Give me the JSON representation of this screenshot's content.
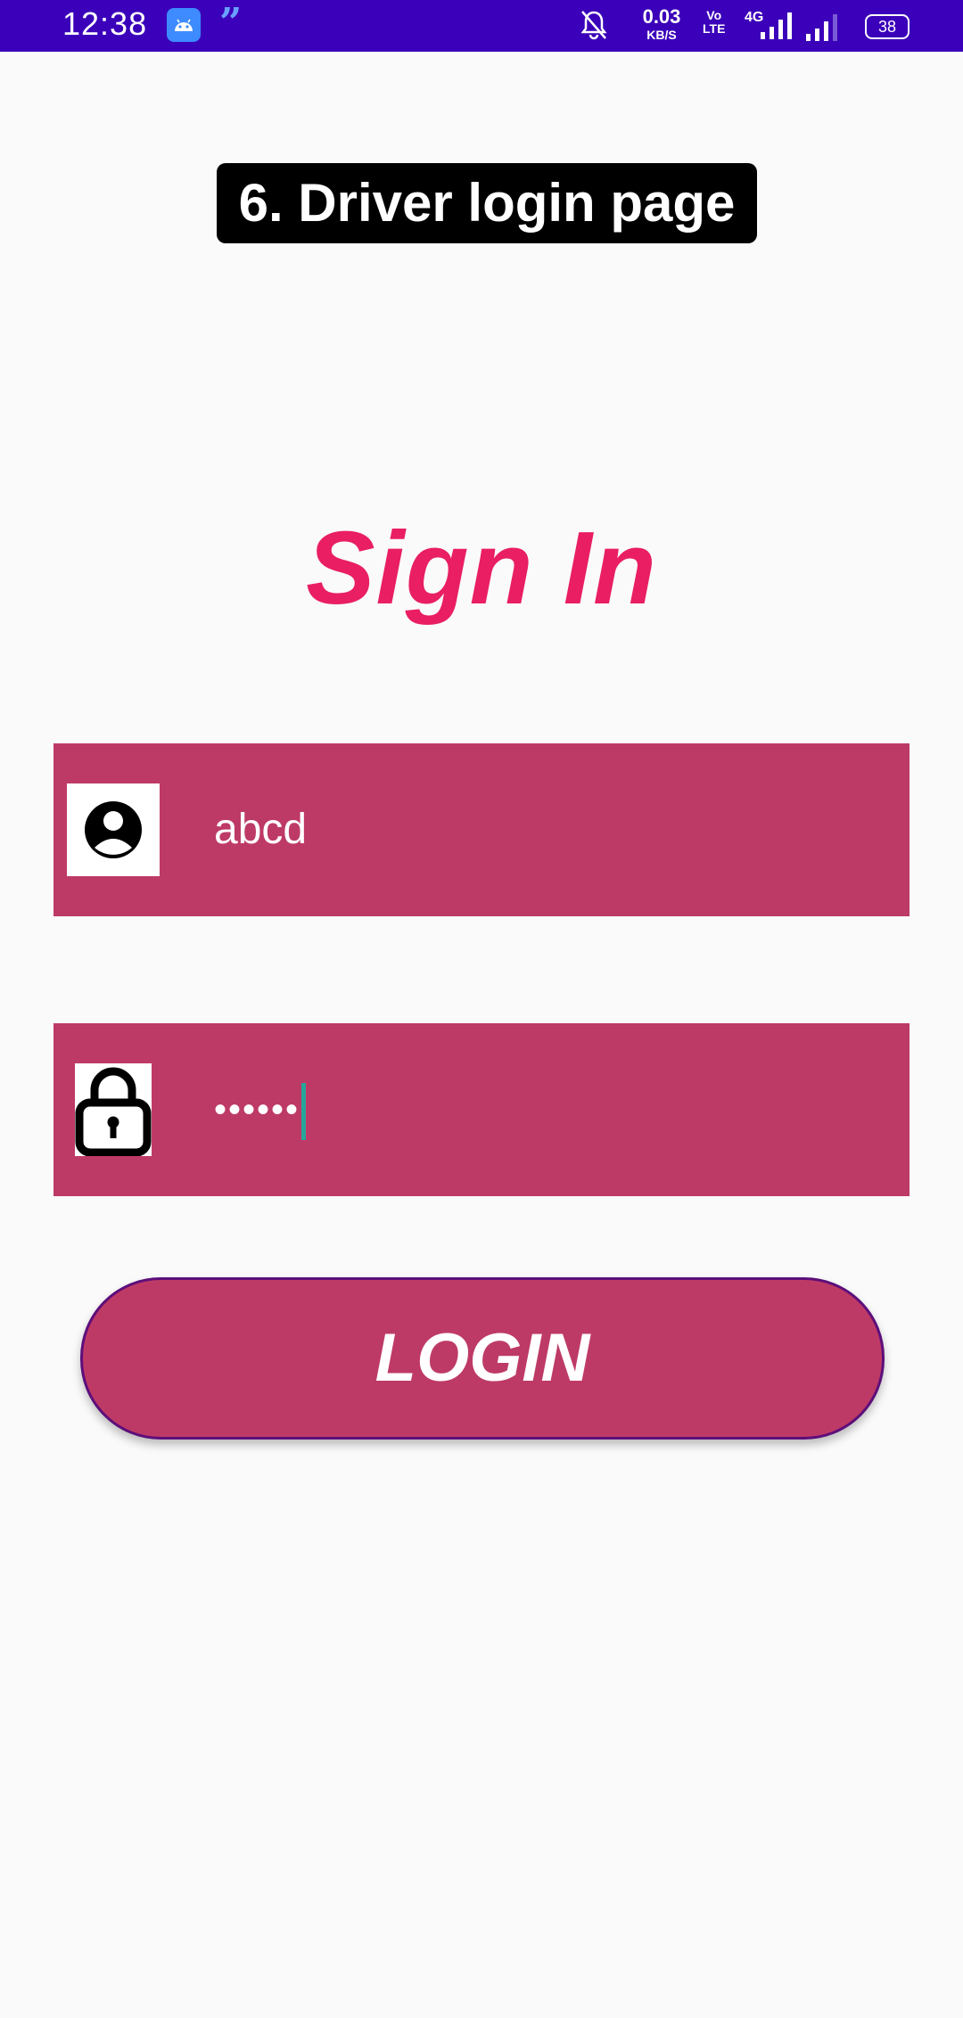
{
  "status_bar": {
    "time": "12:38",
    "net_speed_value": "0.03",
    "net_speed_unit": "KB/S",
    "volte_line1": "Vo",
    "volte_line2": "LTE",
    "network_type": "4G",
    "battery": "38",
    "icons": [
      "android-notification-icon",
      "quote-notification-icon",
      "bell-off-icon",
      "signal-icon",
      "signal-icon"
    ]
  },
  "page_label": "6. Driver login page",
  "heading": "Sign In",
  "username_field": {
    "value": "abcd",
    "icon": "user-icon"
  },
  "password_field": {
    "value": "••••••",
    "icon": "lock-icon"
  },
  "login_button": {
    "label": "LOGIN"
  },
  "colors": {
    "status_bar": "#3b00b9",
    "heading": "#e91e63",
    "field_bg": "#be3a66",
    "cursor": "#26a69a",
    "button_border": "#5d0e7a"
  }
}
